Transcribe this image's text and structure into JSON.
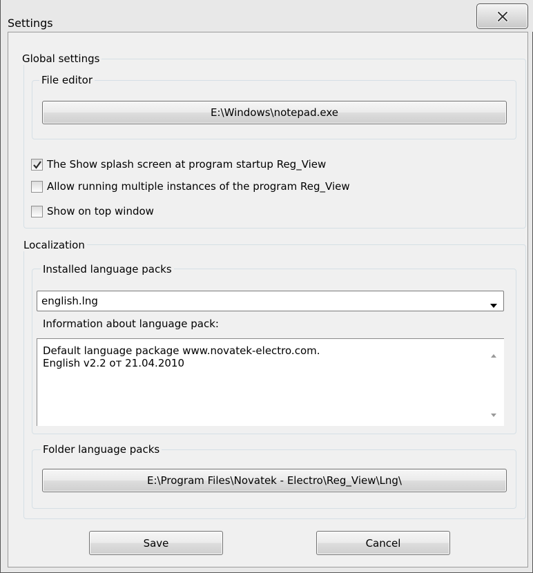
{
  "window": {
    "title": "Settings",
    "close_glyph": "x"
  },
  "global": {
    "label": "Global settings",
    "file_editor": {
      "label": "File editor",
      "path": "E:\\Windows\\notepad.exe"
    },
    "options": [
      {
        "label": "The Show splash screen at program startup Reg_View",
        "checked": true
      },
      {
        "label": "Allow running multiple instances of the program Reg_View",
        "checked": false
      },
      {
        "label": "Show on top window",
        "checked": false
      }
    ]
  },
  "localization": {
    "label": "Localization",
    "installed": {
      "label": "Installed language packs",
      "selected": "english.lng"
    },
    "info_label": "Information about language pack:",
    "info_lines": [
      "Default language package www.novatek-electro.com.",
      "English v2.2 от 21.04.2010"
    ],
    "folder": {
      "label": "Folder language packs",
      "path": "E:\\Program Files\\Novatek - Electro\\Reg_View\\Lng\\"
    }
  },
  "footer": {
    "save_label": "Save",
    "cancel_label": "Cancel"
  },
  "icons": {
    "close": "close-icon",
    "check": "checkmark-icon",
    "dropdown": "chevron-down-icon"
  }
}
